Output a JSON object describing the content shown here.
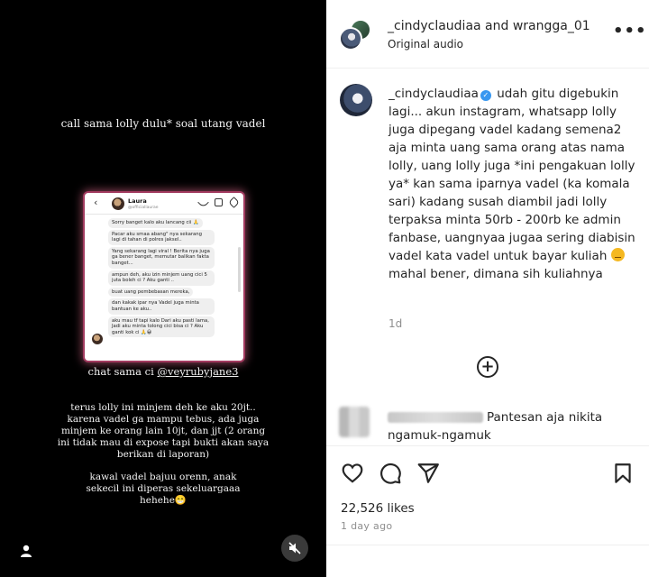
{
  "media": {
    "top_text": "call sama lolly dulu* soal utang vadel",
    "chat_prefix": "chat sama ci ",
    "chat_mention": "@veyrubyjane3",
    "debt_text": "terus lolly ini minjem deh ke aku 20jt.. karena vadel ga mampu tebus, ada juga minjem ke orang lain 10jt, dan jjt (2 orang ini tidak mau di expose tapi bukti akan saya berikan di laporan)",
    "guard_text": "kawal vadel bajuu orenn, anak sekecil ini diperas sekeluargaaa hehehe😁",
    "phone": {
      "name": "Laura",
      "username": "@officiallaurae",
      "messages": [
        "Sorry banget kalo aku lancang cii 🙏",
        "Pacar aku smaa abang\" nya sekarang lagi di tahan di polres jaksel..",
        "Yang sekarang lagi viral ! Berita nya juga ga bener banget, memutar balikan fakta banget...",
        "ampun deh, aku izin minjem uang cici 5 juta boleh ci ? Aku ganti ..",
        "buat uang pembebasan mereka,",
        "dan kakak ipar nya Vadel juga minta bantuan ke aku..",
        "aku mau tf tapi kalo Dari aku pasti lama, Jadi aku minta tolong cici bisa ci ? Aku ganti kok ci 🙏😀"
      ]
    }
  },
  "header": {
    "title": "_cindyclaudiaa and wrangga_01",
    "subtitle": "Original audio",
    "more": "•••"
  },
  "caption": {
    "username": "_cindyclaudiaa",
    "text_before_emoji": " udah gitu digebukin lagi... akun instagram, whatsapp lolly juga dipegang vadel kadang semena2 aja minta uang sama orang atas nama lolly, uang lolly juga *ini pengakuan lolly ya* kan sama iparnya vadel (ka komala sari) kadang susah diambil jadi lolly terpaksa minta 50rb - 200rb ke admin fanbase, uangnyaa jugaa sering diabisin vadel kata vadel untuk bayar kuliah ",
    "text_after_emoji": " mahal bener, dimana sih kuliahnya",
    "time": "1d"
  },
  "add_comment": "+",
  "comment": {
    "text": "Pantesan aja nikita",
    "text_line2": "ngamuk-ngamuk"
  },
  "stats": {
    "likes": "22,526 likes",
    "ago": "1 day ago"
  },
  "colors": {
    "media_bg": "#000000",
    "verified": "#3897f0",
    "muted_text": "#8e8e8e"
  }
}
